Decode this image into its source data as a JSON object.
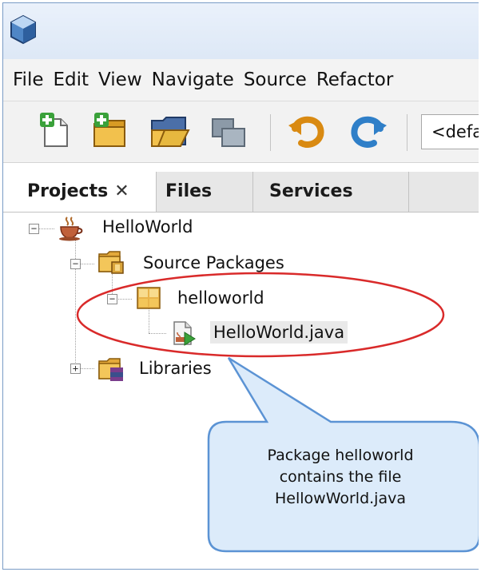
{
  "menu": [
    "File",
    "Edit",
    "View",
    "Navigate",
    "Source",
    "Refactor"
  ],
  "toolbar": {
    "buttons": [
      "new-file-icon",
      "new-project-icon",
      "open-project-icon",
      "close-project-icon",
      "undo-icon",
      "redo-icon"
    ],
    "config_value": "<defa"
  },
  "tabs": {
    "projects": "Projects",
    "files": "Files",
    "services": "Services"
  },
  "tree": {
    "project": "HelloWorld",
    "source_packages": "Source Packages",
    "package": "helloworld",
    "file": "HelloWorld.java",
    "libraries": "Libraries"
  },
  "callout": {
    "line1": "Package helloworld",
    "line2": "contains the file",
    "line3": "HellowWorld.java"
  },
  "colors": {
    "annotation_ellipse": "#d92a2a",
    "callout_fill": "#dcebfa",
    "callout_border": "#5b93d4"
  }
}
